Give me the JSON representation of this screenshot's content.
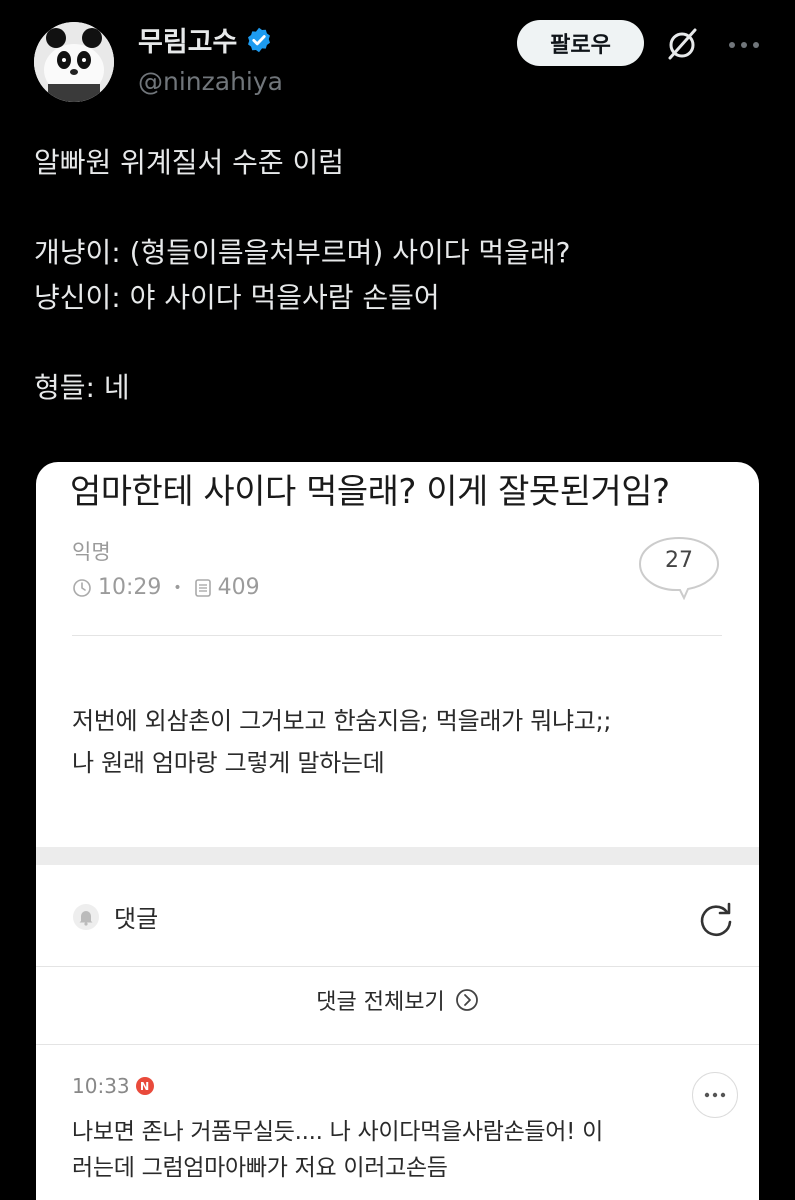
{
  "header": {
    "display_name": "무림고수",
    "handle": "@ninzahiya",
    "follow_label": "팔로우",
    "verified_color": "#1d9bf0"
  },
  "tweet": {
    "lines": [
      "알빠원 위계질서 수준 이럼",
      "개냥이: (형들이름을처부르며) 사이다 먹을래?",
      "냥신이: 야 사이다 먹을사람 손들어",
      "형들: 네"
    ]
  },
  "embedded": {
    "title": "엄마한테 사이다 먹을래? 이게 잘못된거임?",
    "author": "익명",
    "time": "10:29",
    "views": "409",
    "comment_count": "27",
    "body_lines": [
      "저번에 외삼촌이 그거보고 한숨지음; 먹을래가 뭐냐고;;",
      "나 원래 엄마랑 그렇게 말하는데"
    ],
    "comments_label": "댓글",
    "view_all_label": "댓글 전체보기",
    "comment": {
      "time": "10:33",
      "badge": "N",
      "lines": [
        "나보면 존나 거품무실듯.... 나 사이다먹을사람손들어! 이",
        "러는데 그럼엄마아빠가 저요 이러고손듬"
      ]
    }
  }
}
